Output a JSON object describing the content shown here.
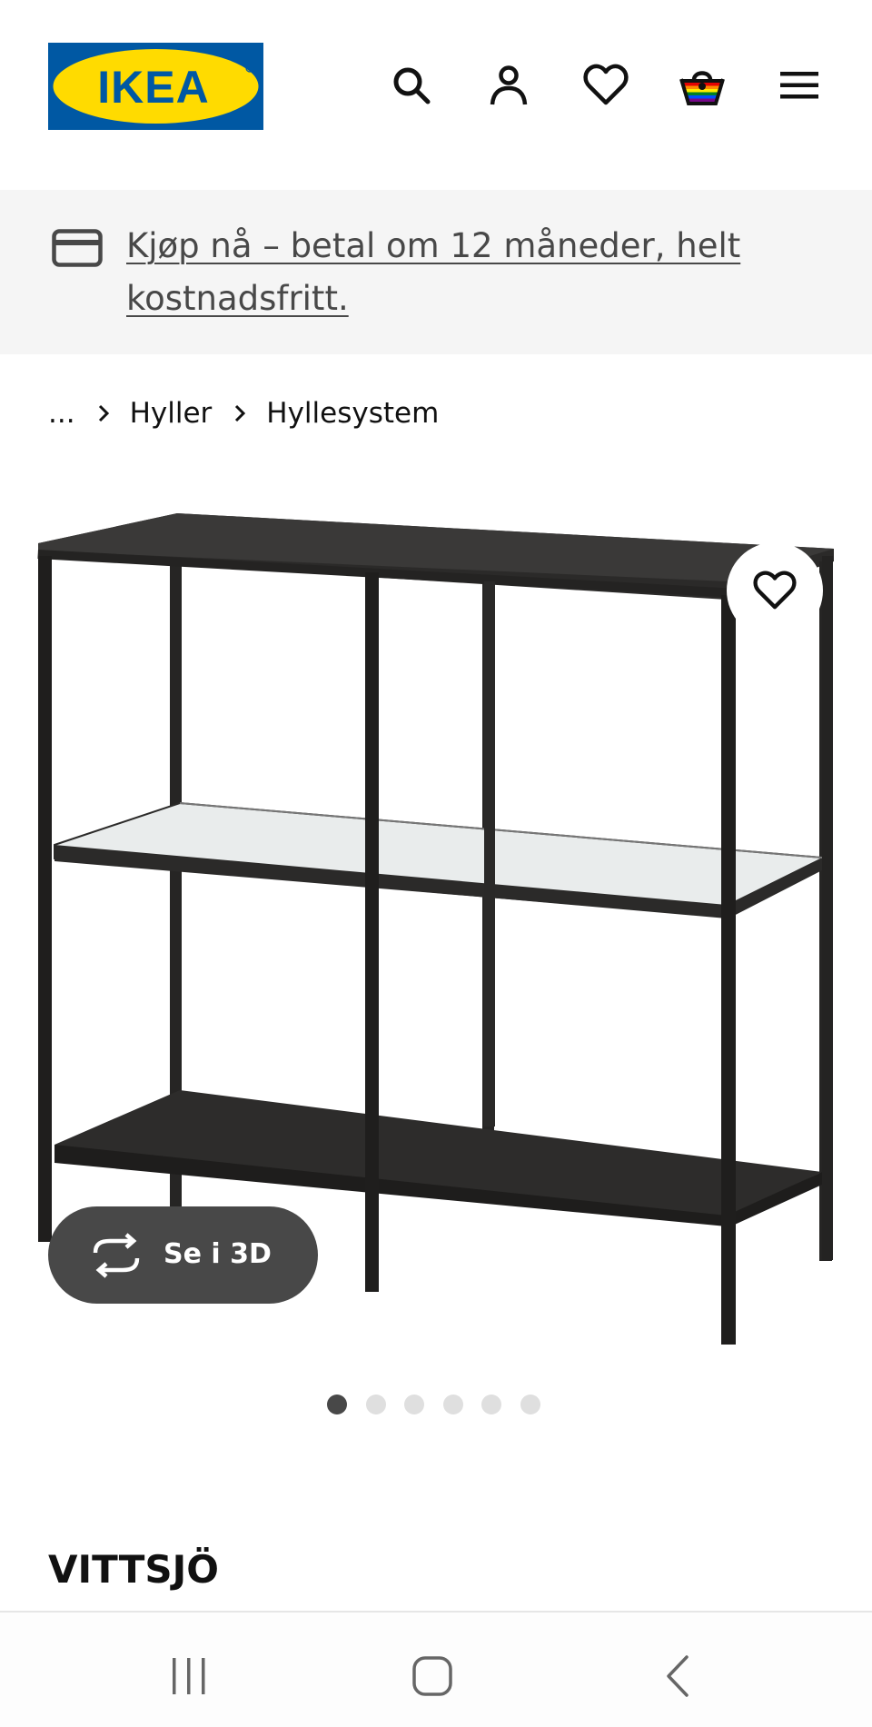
{
  "header": {
    "logo_text": "IKEA",
    "brand_colors": {
      "blue": "#0058a3",
      "yellow": "#ffdb00"
    },
    "icons": [
      "search-icon",
      "account-icon",
      "wishlist-icon",
      "basket-icon",
      "menu-icon"
    ]
  },
  "promo": {
    "icon": "credit-card-icon",
    "text": "Kjøp nå – betal om 12 måneder, helt kostnadsfritt."
  },
  "breadcrumb": {
    "ellipsis": "...",
    "items": [
      "Hyller",
      "Hyllesystem"
    ]
  },
  "gallery": {
    "favorite_icon": "heart-icon",
    "view_3d_label": "Se i 3D",
    "view_3d_icon": "rotate-icon",
    "image_count": 6,
    "active_index": 0
  },
  "product": {
    "name": "VITTSJÖ"
  },
  "system_nav": {
    "icons": [
      "recent-apps-icon",
      "home-icon",
      "back-icon"
    ]
  }
}
